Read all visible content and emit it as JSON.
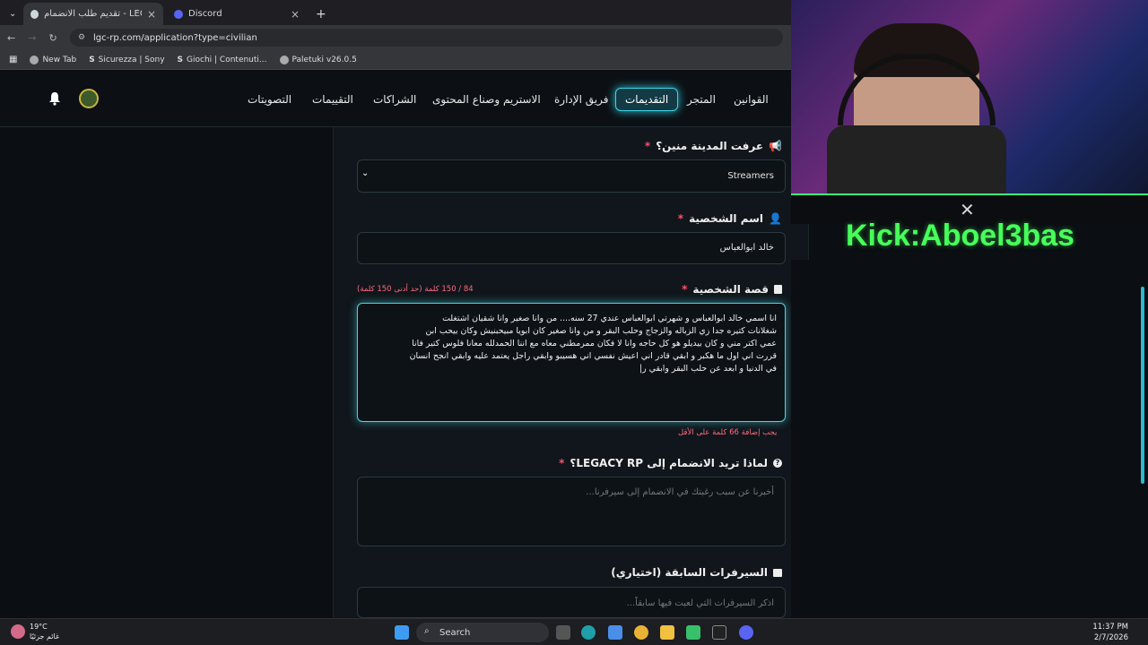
{
  "browser": {
    "tabs": [
      {
        "title": "تقديم طلب الانضمام - LEGACY RP",
        "active": true
      },
      {
        "title": "Discord",
        "active": false
      }
    ],
    "url": "lgc-rp.com/application?type=civilian",
    "bookmarks": [
      "New Tab",
      "Sicurezza | Sony",
      "Giochi | Contenuti...",
      "Paletuki v26.0.5"
    ]
  },
  "nav": {
    "items": [
      "القوانين",
      "المتجر",
      "التقديمات",
      "فريق الإدارة",
      "الاستريم وصناع المحتوى",
      "الشراكات",
      "التقييمات",
      "التصويتات"
    ],
    "active": "التقديمات"
  },
  "form": {
    "city_source": {
      "label": "عرفت المدينة منين؟",
      "value": "Streamers"
    },
    "character_name": {
      "label": "اسم الشخصية",
      "value": "خالد ابوالعباس"
    },
    "character_story": {
      "label": "قصة الشخصية",
      "counter": "84 / 150 كلمة (حد أدنى 150 كلمة)",
      "lines": [
        "انا اسمي خالد ابوالعباس و شهرتي ابوالعباس  عندي 27 سنه....  من وانا صغير وانا شقيان اشتغلت",
        "شغلانات كتيره جدا زي الزباله والزجاج  وحلب البقر  و من وانا صغير كان ابويا مبيحبنيش وكان بيحب ابن",
        "عمي اكتر مني و كان بيديلو هو كل حاجه وانا لا فكان ممرمطني معاه مع اننا الحمدلله معانا فلوس كتير فانا",
        "قررت اني اول ما هكبر و ابقي قادر اني اعيش نفسي اني هسيبو وابقي راجل يعتمد عليه وابقي انجح  انسان",
        "في الدنيا و ابعد عن  حلب البقر وابقي ر|"
      ],
      "hint": "يجب إضافة 66 كلمة على الأقل"
    },
    "why_join": {
      "label": "لماذا تريد الانضمام إلى LEGACY RP؟",
      "placeholder": "أخبرنا عن سبب رغبتك في الانضمام إلى سيرفرنا..."
    },
    "previous_servers": {
      "label": "السيرفرات السابقة (اختياري)",
      "placeholder": "اذكر السيرفرات التي لعبت فيها سابقاً..."
    },
    "required_mark": "*"
  },
  "stream": {
    "kick": "Kick:Aboel3bas"
  },
  "taskbar": {
    "weather_temp": "19°C",
    "weather_desc": "غائم جزئيًا",
    "search": "Search",
    "time": "11:37 PM",
    "date": "2/7/2026"
  },
  "colors": {
    "accent": "#49d6e6",
    "required": "#ff4f6a",
    "kick": "#47ff5a"
  }
}
